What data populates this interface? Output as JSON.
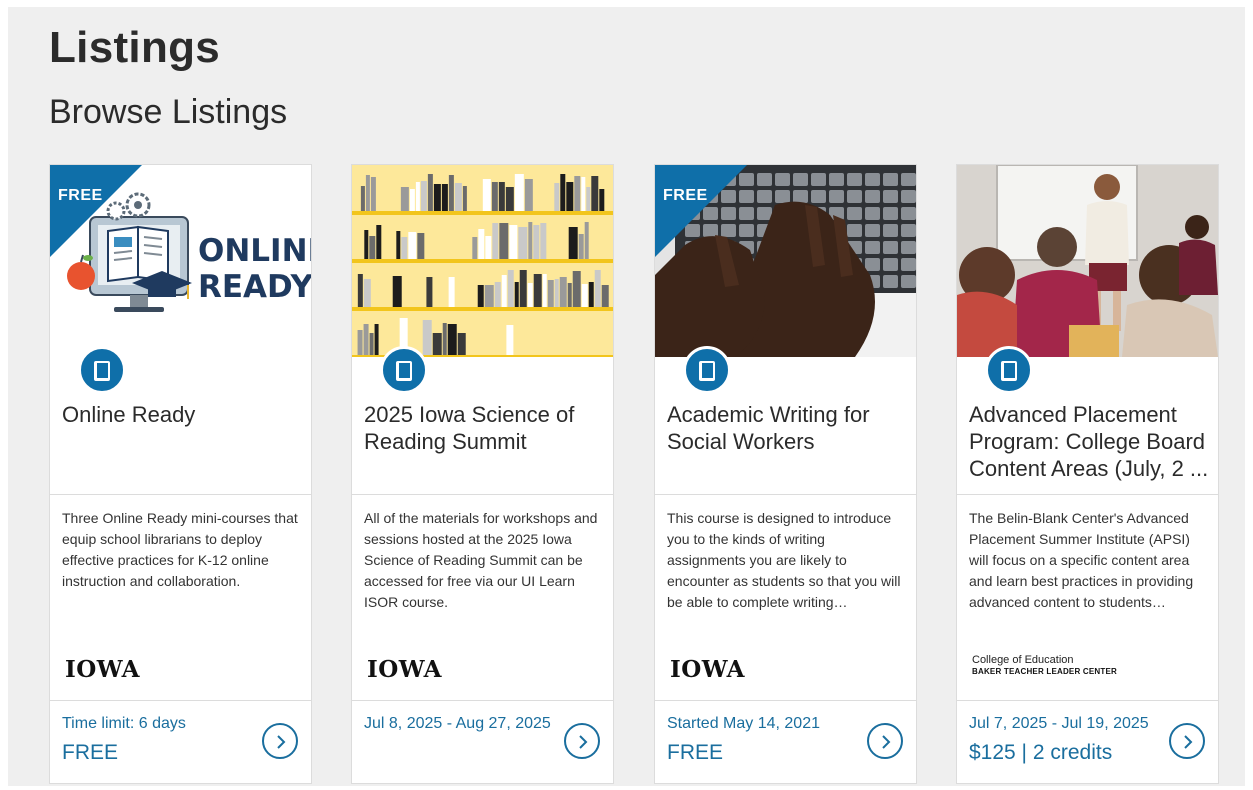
{
  "page": {
    "title": "Listings",
    "subtitle": "Browse Listings"
  },
  "colors": {
    "accent": "#0f6fa9",
    "link": "#1a6e9e",
    "background": "#efefef"
  },
  "listings": [
    {
      "free_ribbon": "FREE",
      "image": "online-ready-illustration",
      "image_text_1": "ONLINE",
      "image_text_2": "READY",
      "icon": "book-icon",
      "title": "Online Ready",
      "description": "Three Online Ready mini-courses that equip school librarians to deploy effective practices for K-12 online instruction and collaboration.",
      "provider": "IOWA",
      "date": "Time limit: 6 days",
      "price": "FREE"
    },
    {
      "free_ribbon": "",
      "image": "bookshelf-illustration",
      "icon": "book-icon",
      "title": "2025 Iowa Science of Reading Summit",
      "description": "All of the materials for workshops and sessions hosted at the 2025 Iowa Science of Reading Summit can be accessed for free via our UI Learn ISOR course.",
      "provider": "IOWA",
      "date": "Jul 8, 2025 - Aug 27, 2025",
      "price": ""
    },
    {
      "free_ribbon": "FREE",
      "image": "hands-typing-photo",
      "icon": "book-icon",
      "title": "Academic Writing for Social Workers",
      "description": "This course is designed to introduce you to the kinds of writing assignments you are likely to encounter as students so that you will be able to complete writing…",
      "provider": "IOWA",
      "date": "Started May 14, 2021",
      "price": "FREE"
    },
    {
      "free_ribbon": "",
      "image": "classroom-photo",
      "icon": "book-icon",
      "title": "Advanced Placement Program: College Board Content Areas (July, 2 ...",
      "description": "The Belin-Blank Center's Advanced Placement Summer Institute (APSI) will focus on a specific content area and learn best practices in providing advanced content to students…",
      "provider_line1": "College of Education",
      "provider_line2": "BAKER TEACHER LEADER CENTER",
      "date": "Jul 7, 2025 - Jul 19, 2025",
      "price": "$125 | 2 credits"
    }
  ]
}
